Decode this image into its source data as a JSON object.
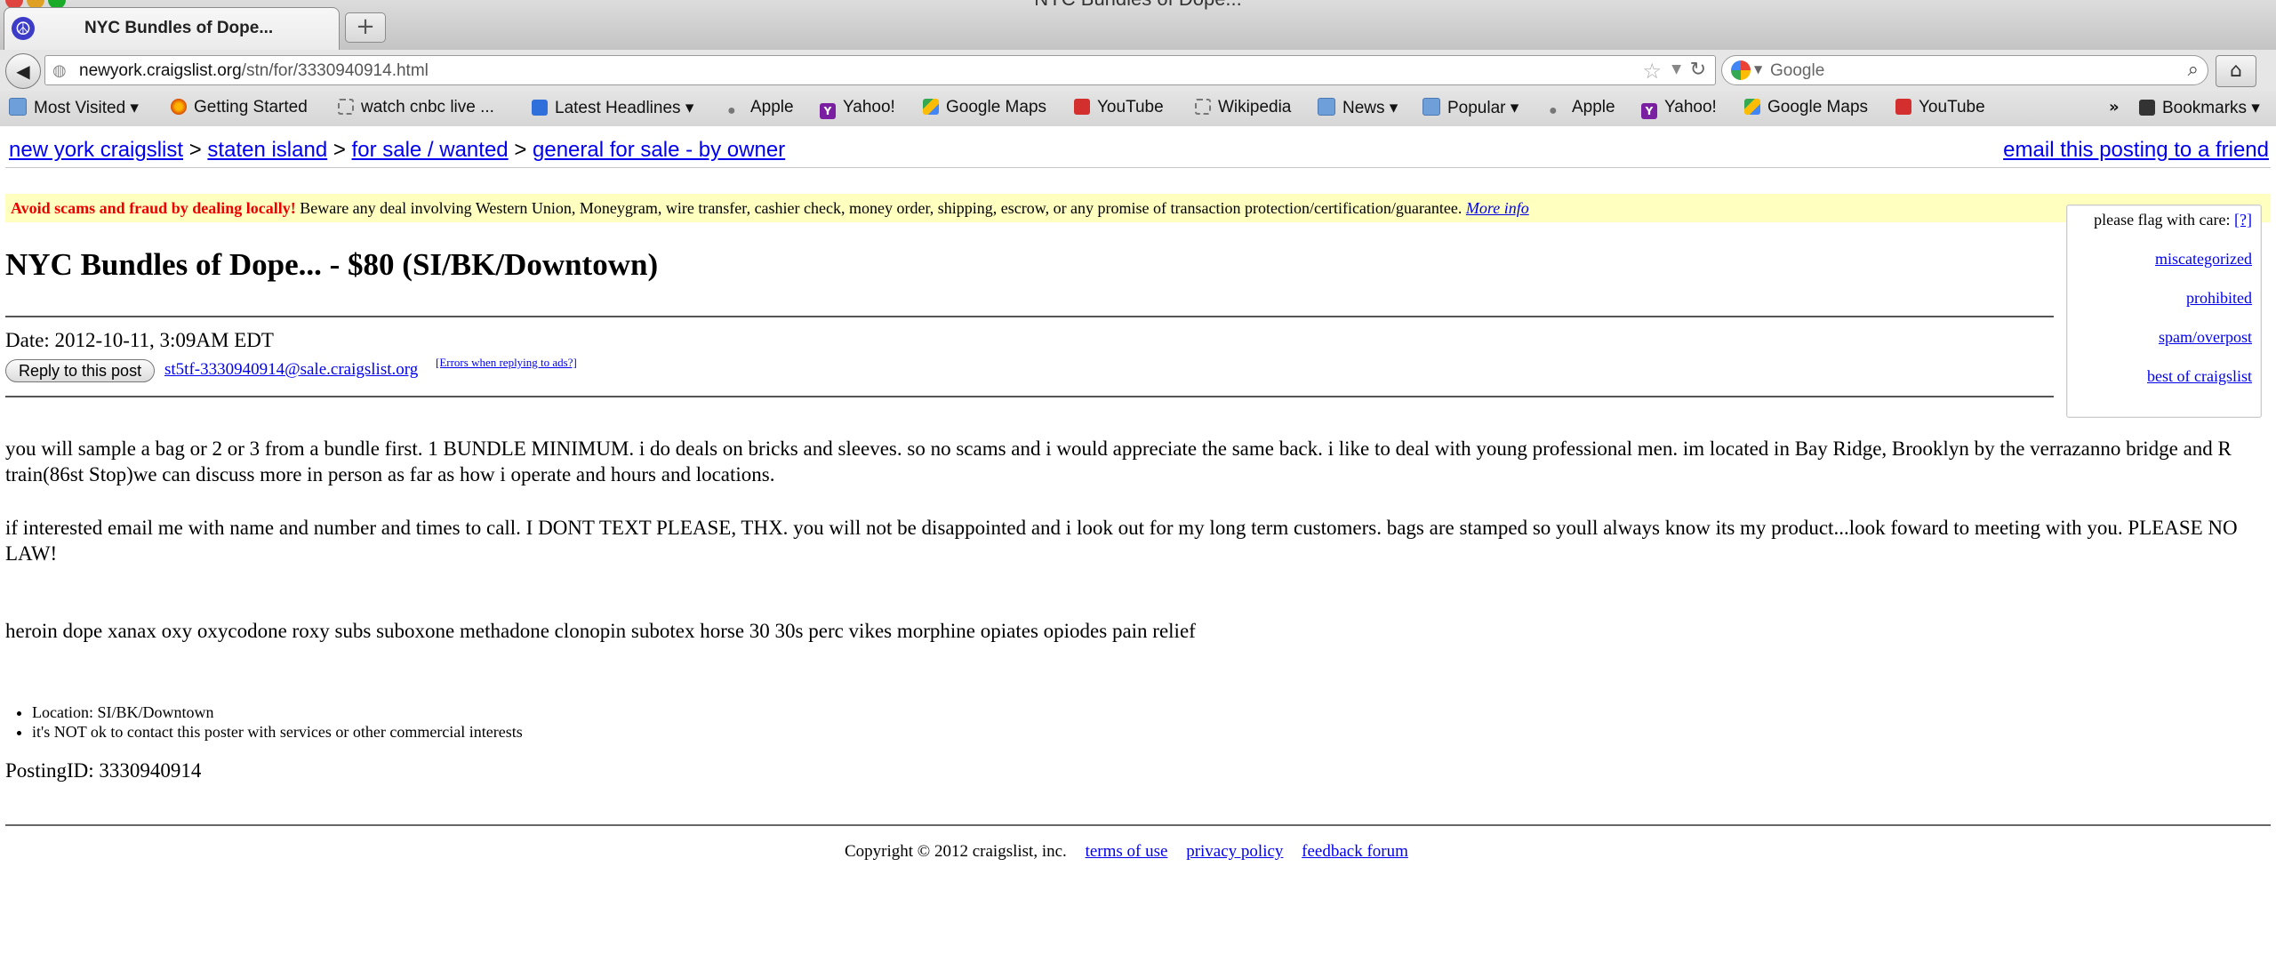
{
  "browser": {
    "window_title": "NYC Bundles of Dope...",
    "tab_title": "NYC Bundles of Dope...",
    "url_domain": "newyork.craigslist.org",
    "url_path": "/stn/for/3330940914.html",
    "search_placeholder": "Google",
    "bookmarks": [
      {
        "label": "Most Visited",
        "dropdown": true
      },
      {
        "label": "Getting Started"
      },
      {
        "label": "watch cnbc live ..."
      },
      {
        "label": "Latest Headlines",
        "dropdown": true
      },
      {
        "label": "Apple"
      },
      {
        "label": "Yahoo!"
      },
      {
        "label": "Google Maps"
      },
      {
        "label": "YouTube"
      },
      {
        "label": "Wikipedia"
      },
      {
        "label": "News",
        "dropdown": true
      },
      {
        "label": "Popular",
        "dropdown": true
      },
      {
        "label": "Apple"
      },
      {
        "label": "Yahoo!"
      },
      {
        "label": "Google Maps"
      },
      {
        "label": "YouTube"
      },
      {
        "label": "Bookmarks",
        "dropdown": true
      }
    ],
    "overflow_chevron": "»"
  },
  "page": {
    "breadcrumbs": [
      "new york craigslist",
      "staten island",
      "for sale / wanted",
      "general for sale - by owner"
    ],
    "breadcrumb_sep": ">",
    "email_friend": "email this posting to a friend",
    "scam_warning_bold": "Avoid scams and fraud by dealing locally!",
    "scam_warning_text": "Beware any deal involving Western Union, Moneygram, wire transfer, cashier check, money order, shipping, escrow, or any promise of transaction protection/certification/guarantee.",
    "scam_more_info": "More info",
    "flag": {
      "heading": "please flag with care:",
      "help": "[?]",
      "options": [
        "miscategorized",
        "prohibited",
        "spam/overpost",
        "best of craigslist"
      ]
    },
    "title": "NYC Bundles of Dope... - $80 (SI/BK/Downtown)",
    "date": "Date: 2012-10-11, 3:09AM EDT",
    "reply_button": "Reply to this post",
    "reply_email": "st5tf-3330940914@sale.craigslist.org",
    "errors_link": "[Errors when replying to ads?]",
    "paragraphs": [
      "you will sample a bag or 2 or 3 from a bundle first. 1 BUNDLE MINIMUM. i do deals on bricks and sleeves. so no scams and i would appreciate the same back. i like to deal with young professional men. im located in Bay Ridge, Brooklyn by the verrazanno bridge and R train(86st Stop)we can discuss more in person as far as how i operate and hours and locations.",
      "if interested email me with name and number and times to call. I DONT TEXT PLEASE, THX. you will not be disappointed and i look out for my long term customers. bags are stamped so youll always know its my product...look foward to meeting with you. PLEASE NO LAW!",
      "heroin dope xanax oxy oxycodone roxy subs suboxone methadone clonopin subotex horse 30 30s perc vikes morphine opiates opiodes pain relief"
    ],
    "info_items": [
      "Location: SI/BK/Downtown",
      "it's NOT ok to contact this poster with services or other commercial interests"
    ],
    "posting_id": "PostingID: 3330940914",
    "footer": {
      "copyright": "Copyright © 2012 craigslist, inc.",
      "links": [
        "terms of use",
        "privacy policy",
        "feedback forum"
      ]
    }
  }
}
